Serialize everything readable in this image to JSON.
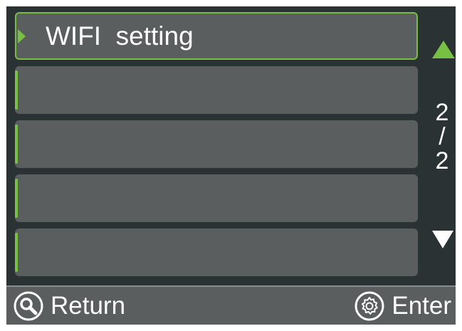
{
  "menu": {
    "items": [
      {
        "label": "WIFI  setting",
        "selected": true
      },
      {
        "label": "",
        "selected": false
      },
      {
        "label": "",
        "selected": false
      },
      {
        "label": "",
        "selected": false
      },
      {
        "label": "",
        "selected": false
      }
    ]
  },
  "pagination": {
    "current": "2",
    "separator": "/",
    "total": "2"
  },
  "footer": {
    "return_label": "Return",
    "enter_label": "Enter"
  },
  "icons": {
    "scroll_up": "triangle-up-icon",
    "scroll_down": "triangle-down-icon",
    "return": "magnifier-icon",
    "enter": "gear-icon",
    "selection": "triangle-right-icon"
  },
  "colors": {
    "accent": "#77c043",
    "background": "#2a3234",
    "item": "#5b5e5f",
    "text": "#ffffff"
  }
}
